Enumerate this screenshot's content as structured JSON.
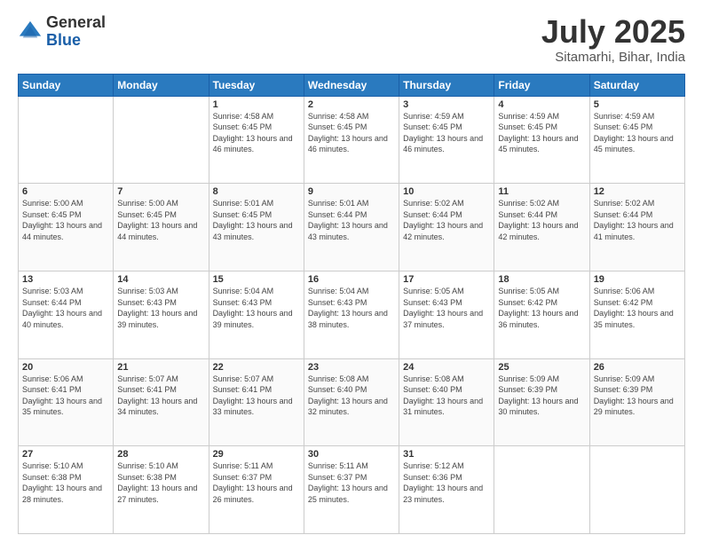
{
  "header": {
    "logo_general": "General",
    "logo_blue": "Blue",
    "month_title": "July 2025",
    "location": "Sitamarhi, Bihar, India"
  },
  "days_of_week": [
    "Sunday",
    "Monday",
    "Tuesday",
    "Wednesday",
    "Thursday",
    "Friday",
    "Saturday"
  ],
  "weeks": [
    [
      {
        "num": "",
        "info": ""
      },
      {
        "num": "",
        "info": ""
      },
      {
        "num": "1",
        "info": "Sunrise: 4:58 AM\nSunset: 6:45 PM\nDaylight: 13 hours and 46 minutes."
      },
      {
        "num": "2",
        "info": "Sunrise: 4:58 AM\nSunset: 6:45 PM\nDaylight: 13 hours and 46 minutes."
      },
      {
        "num": "3",
        "info": "Sunrise: 4:59 AM\nSunset: 6:45 PM\nDaylight: 13 hours and 46 minutes."
      },
      {
        "num": "4",
        "info": "Sunrise: 4:59 AM\nSunset: 6:45 PM\nDaylight: 13 hours and 45 minutes."
      },
      {
        "num": "5",
        "info": "Sunrise: 4:59 AM\nSunset: 6:45 PM\nDaylight: 13 hours and 45 minutes."
      }
    ],
    [
      {
        "num": "6",
        "info": "Sunrise: 5:00 AM\nSunset: 6:45 PM\nDaylight: 13 hours and 44 minutes."
      },
      {
        "num": "7",
        "info": "Sunrise: 5:00 AM\nSunset: 6:45 PM\nDaylight: 13 hours and 44 minutes."
      },
      {
        "num": "8",
        "info": "Sunrise: 5:01 AM\nSunset: 6:45 PM\nDaylight: 13 hours and 43 minutes."
      },
      {
        "num": "9",
        "info": "Sunrise: 5:01 AM\nSunset: 6:44 PM\nDaylight: 13 hours and 43 minutes."
      },
      {
        "num": "10",
        "info": "Sunrise: 5:02 AM\nSunset: 6:44 PM\nDaylight: 13 hours and 42 minutes."
      },
      {
        "num": "11",
        "info": "Sunrise: 5:02 AM\nSunset: 6:44 PM\nDaylight: 13 hours and 42 minutes."
      },
      {
        "num": "12",
        "info": "Sunrise: 5:02 AM\nSunset: 6:44 PM\nDaylight: 13 hours and 41 minutes."
      }
    ],
    [
      {
        "num": "13",
        "info": "Sunrise: 5:03 AM\nSunset: 6:44 PM\nDaylight: 13 hours and 40 minutes."
      },
      {
        "num": "14",
        "info": "Sunrise: 5:03 AM\nSunset: 6:43 PM\nDaylight: 13 hours and 39 minutes."
      },
      {
        "num": "15",
        "info": "Sunrise: 5:04 AM\nSunset: 6:43 PM\nDaylight: 13 hours and 39 minutes."
      },
      {
        "num": "16",
        "info": "Sunrise: 5:04 AM\nSunset: 6:43 PM\nDaylight: 13 hours and 38 minutes."
      },
      {
        "num": "17",
        "info": "Sunrise: 5:05 AM\nSunset: 6:43 PM\nDaylight: 13 hours and 37 minutes."
      },
      {
        "num": "18",
        "info": "Sunrise: 5:05 AM\nSunset: 6:42 PM\nDaylight: 13 hours and 36 minutes."
      },
      {
        "num": "19",
        "info": "Sunrise: 5:06 AM\nSunset: 6:42 PM\nDaylight: 13 hours and 35 minutes."
      }
    ],
    [
      {
        "num": "20",
        "info": "Sunrise: 5:06 AM\nSunset: 6:41 PM\nDaylight: 13 hours and 35 minutes."
      },
      {
        "num": "21",
        "info": "Sunrise: 5:07 AM\nSunset: 6:41 PM\nDaylight: 13 hours and 34 minutes."
      },
      {
        "num": "22",
        "info": "Sunrise: 5:07 AM\nSunset: 6:41 PM\nDaylight: 13 hours and 33 minutes."
      },
      {
        "num": "23",
        "info": "Sunrise: 5:08 AM\nSunset: 6:40 PM\nDaylight: 13 hours and 32 minutes."
      },
      {
        "num": "24",
        "info": "Sunrise: 5:08 AM\nSunset: 6:40 PM\nDaylight: 13 hours and 31 minutes."
      },
      {
        "num": "25",
        "info": "Sunrise: 5:09 AM\nSunset: 6:39 PM\nDaylight: 13 hours and 30 minutes."
      },
      {
        "num": "26",
        "info": "Sunrise: 5:09 AM\nSunset: 6:39 PM\nDaylight: 13 hours and 29 minutes."
      }
    ],
    [
      {
        "num": "27",
        "info": "Sunrise: 5:10 AM\nSunset: 6:38 PM\nDaylight: 13 hours and 28 minutes."
      },
      {
        "num": "28",
        "info": "Sunrise: 5:10 AM\nSunset: 6:38 PM\nDaylight: 13 hours and 27 minutes."
      },
      {
        "num": "29",
        "info": "Sunrise: 5:11 AM\nSunset: 6:37 PM\nDaylight: 13 hours and 26 minutes."
      },
      {
        "num": "30",
        "info": "Sunrise: 5:11 AM\nSunset: 6:37 PM\nDaylight: 13 hours and 25 minutes."
      },
      {
        "num": "31",
        "info": "Sunrise: 5:12 AM\nSunset: 6:36 PM\nDaylight: 13 hours and 23 minutes."
      },
      {
        "num": "",
        "info": ""
      },
      {
        "num": "",
        "info": ""
      }
    ]
  ]
}
